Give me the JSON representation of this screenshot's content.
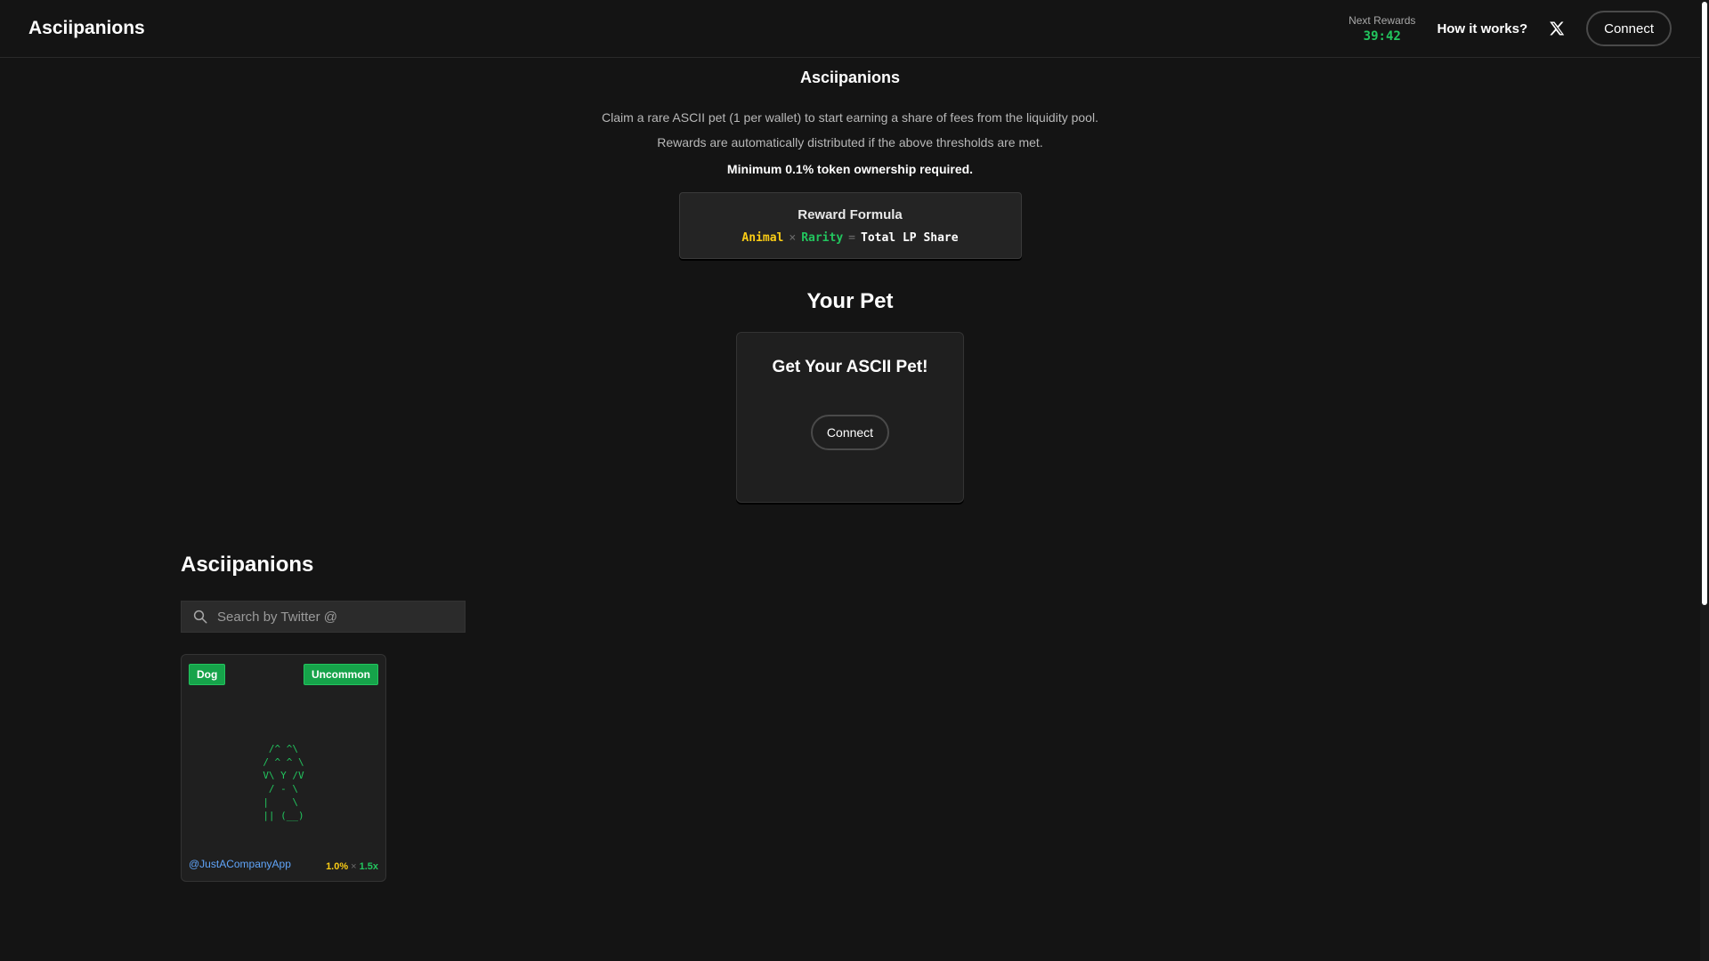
{
  "header": {
    "brand": "Asciipanions",
    "next_rewards_label": "Next Rewards",
    "next_rewards_timer": "39:42",
    "how_it_works": "How it works?",
    "x_icon": "x-logo-icon",
    "connect_label": "Connect"
  },
  "hero": {
    "title": "Asciipanions",
    "desc_line1": "Claim a rare ASCII pet (1 per wallet) to start earning a share of fees from the liquidity pool.",
    "desc_line2": "Rewards are automatically distributed if the above thresholds are met.",
    "minimum": "Minimum 0.1% token ownership required.",
    "formula": {
      "title": "Reward Formula",
      "animal": "Animal",
      "times": "×",
      "rarity": "Rarity",
      "equals": "=",
      "result": "Total LP Share"
    }
  },
  "your_pet": {
    "title": "Your Pet",
    "card_title": "Get Your ASCII Pet!",
    "connect_label": "Connect"
  },
  "gallery": {
    "title": "Asciipanions",
    "search_placeholder": "Search by Twitter @",
    "search_icon": "search-icon",
    "pets": [
      {
        "animal": "Dog",
        "rarity": "Uncommon",
        "ascii": " /^ ^\\ \n/ ^ ^ \\\nV\\ Y /V\n / - \\ \n|    \\ \n|| (__)",
        "handle": "@JustACompanyApp",
        "percent": "1.0%",
        "times": "×",
        "multiplier": "1.5x"
      }
    ]
  },
  "colors": {
    "background": "#141414",
    "accent_green": "#22c55e",
    "accent_yellow": "#facc15",
    "link_blue": "#60a5fa"
  }
}
